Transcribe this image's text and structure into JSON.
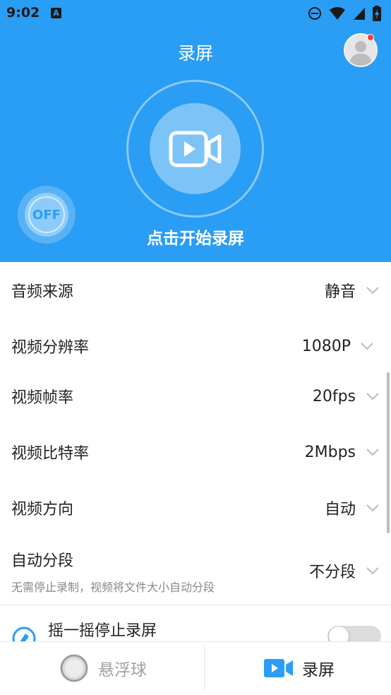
{
  "status_bar": {
    "time": "9:02",
    "notification_icon": "A"
  },
  "header": {
    "title": "录屏",
    "start_label": "点击开始录屏",
    "floating_toggle": "OFF"
  },
  "settings": [
    {
      "label": "音频来源",
      "value": "静音"
    },
    {
      "label": "视频分辨率",
      "value": "1080P"
    },
    {
      "label": "视频帧率",
      "value": "20fps"
    },
    {
      "label": "视频比特率",
      "value": "2Mbps"
    },
    {
      "label": "视频方向",
      "value": "自动"
    },
    {
      "label": "自动分段",
      "value": "不分段",
      "sub": "无需停止录制，视频将文件大小自动分段"
    }
  ],
  "shake": {
    "label": "摇一摇停止录屏",
    "enabled": false
  },
  "bottom_nav": {
    "floating_ball": "悬浮球",
    "record": "录屏"
  },
  "colors": {
    "accent": "#2a9df4",
    "toggle_off": "#dcdcdc"
  }
}
